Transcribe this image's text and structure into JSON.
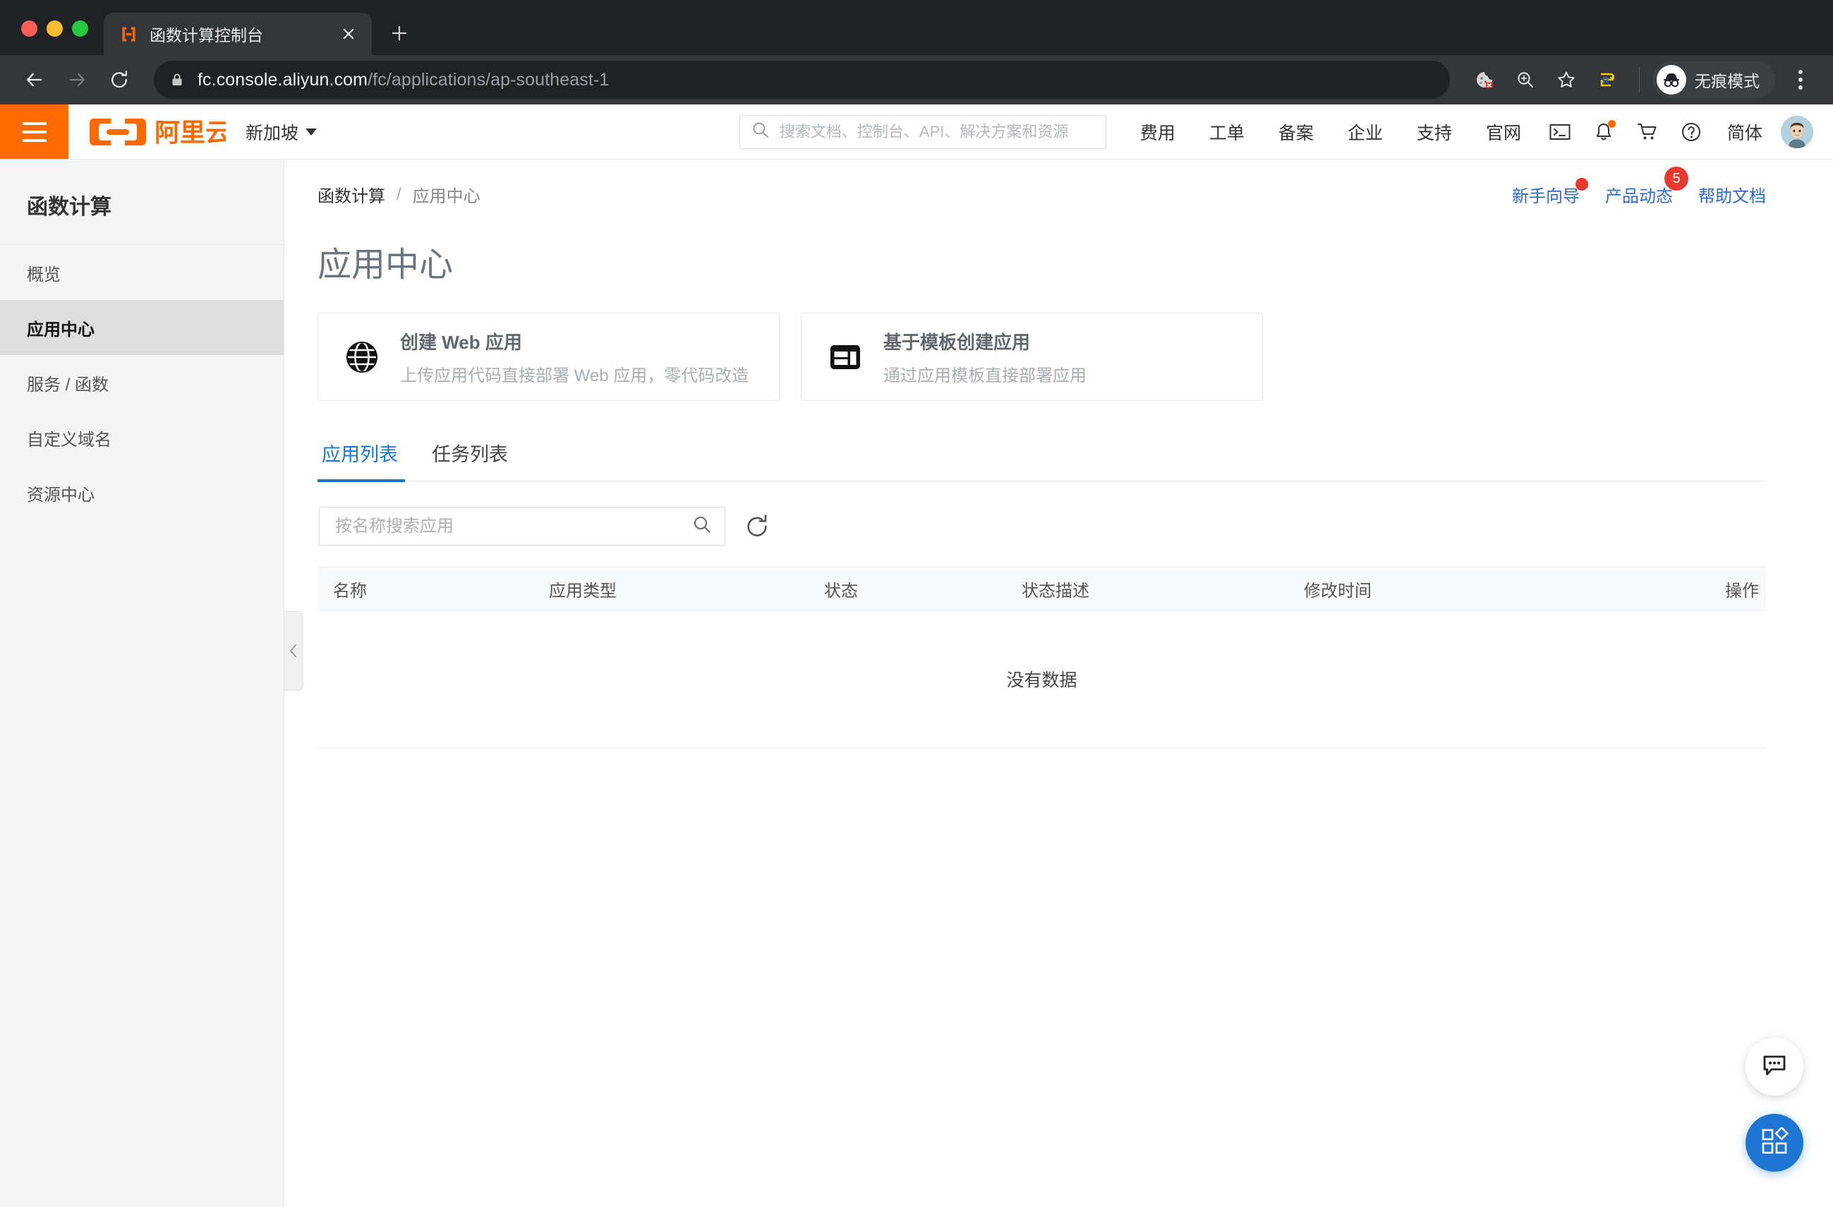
{
  "browser": {
    "tab": {
      "title": "函数计算控制台",
      "favicon_icon": "aliyun-fc-favicon",
      "close_icon": "close-icon"
    },
    "new_tab_label": "+",
    "nav": {
      "back_icon": "arrow-left-icon",
      "forward_icon": "arrow-right-icon",
      "reload_icon": "reload-icon"
    },
    "omnibox": {
      "lock_icon": "lock-icon",
      "url_host": "fc.console.aliyun.com",
      "url_path": "/fc/applications/ap-southeast-1"
    },
    "toolbar_icons": [
      "cookie-blocked-icon",
      "zoom-in-icon",
      "bookmark-star-icon",
      "extension-r-icon"
    ],
    "incognito": {
      "label": "无痕模式",
      "icon": "incognito-hat-icon"
    },
    "menu_icon": "kebab-menu-icon"
  },
  "header": {
    "menu_icon": "hamburger-menu-icon",
    "logo_alt": "阿里云",
    "region": {
      "label": "新加坡",
      "caret_icon": "chevron-down-icon"
    },
    "search": {
      "placeholder": "搜索文档、控制台、API、解决方案和资源",
      "icon": "search-icon",
      "value": ""
    },
    "nav_links": [
      "费用",
      "工单",
      "备案",
      "企业",
      "支持",
      "官网"
    ],
    "icons": [
      {
        "name": "cloudshell-icon",
        "has_dot": false
      },
      {
        "name": "notification-bell-icon",
        "has_dot": true
      },
      {
        "name": "shopping-cart-icon",
        "has_dot": false
      },
      {
        "name": "help-circle-icon",
        "has_dot": false
      }
    ],
    "language": "简体",
    "avatar_icon": "user-avatar"
  },
  "sidebar": {
    "title": "函数计算",
    "items": [
      {
        "label": "概览",
        "active": false
      },
      {
        "label": "应用中心",
        "active": true
      },
      {
        "label": "服务 / 函数",
        "active": false
      },
      {
        "label": "自定义域名",
        "active": false
      },
      {
        "label": "资源中心",
        "active": false
      }
    ],
    "collapse_icon": "chevron-left-icon"
  },
  "main": {
    "breadcrumb": {
      "root": "函数计算",
      "separator": "/",
      "current": "应用中心"
    },
    "help_links": [
      {
        "label": "新手向导",
        "badge_type": "dot",
        "badge": ""
      },
      {
        "label": "产品动态",
        "badge_type": "count",
        "badge": "5"
      },
      {
        "label": "帮助文档",
        "badge_type": "none",
        "badge": ""
      }
    ],
    "page_title": "应用中心",
    "cards": [
      {
        "title": "创建 Web 应用",
        "subtitle": "上传应用代码直接部署 Web 应用，零代码改造",
        "icon": "globe-icon"
      },
      {
        "title": "基于模板创建应用",
        "subtitle": "通过应用模板直接部署应用",
        "icon": "template-layout-icon"
      }
    ],
    "tabs": [
      {
        "label": "应用列表",
        "active": true
      },
      {
        "label": "任务列表",
        "active": false
      }
    ],
    "search": {
      "placeholder": "按名称搜索应用",
      "value": "",
      "icon": "search-icon"
    },
    "refresh_icon": "refresh-icon",
    "table": {
      "columns": [
        "名称",
        "应用类型",
        "状态",
        "状态描述",
        "修改时间",
        "操作"
      ],
      "rows": [],
      "empty_text": "没有数据"
    }
  },
  "fabs": [
    {
      "name": "feedback-chat-button",
      "icon": "chat-bubble-icon",
      "style": "light"
    },
    {
      "name": "app-grid-button",
      "icon": "grid-apps-icon",
      "style": "blue"
    }
  ],
  "colors": {
    "brand_orange": "#ff6a00",
    "accent_blue": "#1677d2",
    "badge_red": "#e8382f",
    "chrome_dark": "#202124"
  }
}
